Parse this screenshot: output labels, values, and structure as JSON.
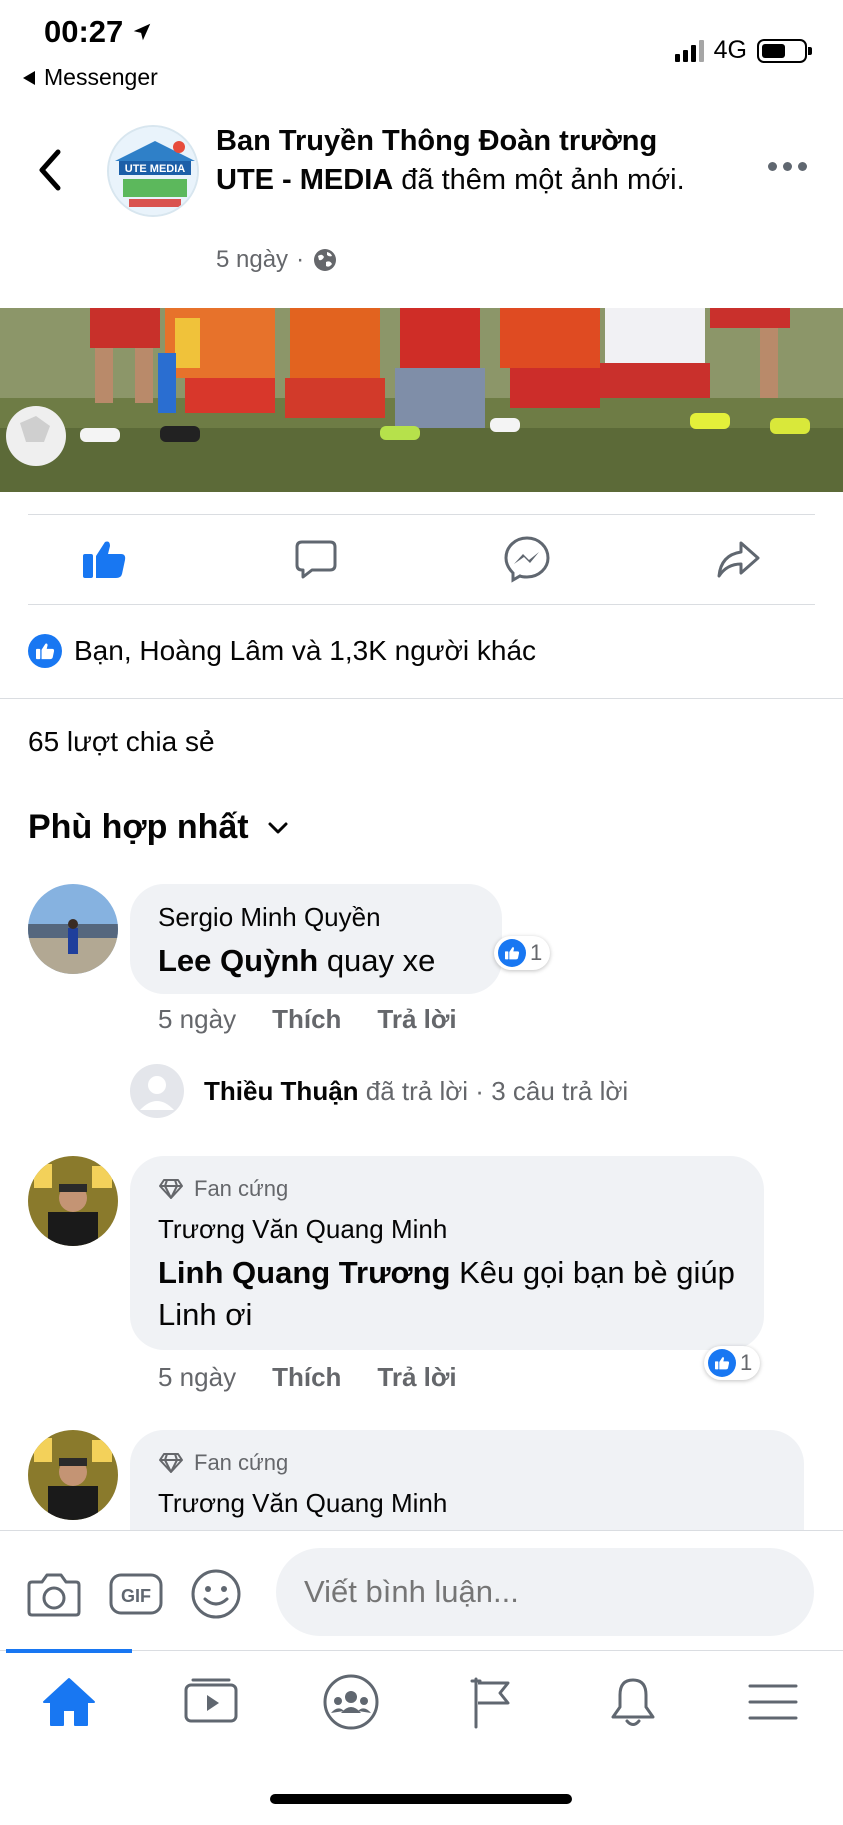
{
  "status_bar": {
    "time": "00:27",
    "back_app": "Messenger",
    "network": "4G"
  },
  "post": {
    "page_name": "Ban Truyền Thông Đoàn trường UTE - MEDIA",
    "action_text": " đã thêm một ảnh mới.",
    "time": "5 ngày",
    "reactions_summary": "Bạn, Hoàng Lâm và 1,3K người khác",
    "shares": "65 lượt chia sẻ"
  },
  "comments_section": {
    "sort_label": "Phù hợp nhất"
  },
  "comments": [
    {
      "author": "Sergio Minh Quyền",
      "tag": "Lee Quỳnh",
      "text": " quay xe",
      "time": "5 ngày",
      "like_label": "Thích",
      "reply_label": "Trả lời",
      "reaction_count": "1"
    },
    {
      "badge": "Fan cứng",
      "author": "Trương Văn Quang Minh",
      "tag": "Linh Quang Trương",
      "text": " Kêu gọi bạn bè giúp Linh ơi",
      "time": "5 ngày",
      "like_label": "Thích",
      "reply_label": "Trả lời",
      "reaction_count": "1"
    },
    {
      "badge": "Fan cứng",
      "author": "Trương Văn Quang Minh"
    }
  ],
  "reply_summary": {
    "author": "Thiều Thuận",
    "text": " đã trả lời · 3 câu trả lời"
  },
  "composer": {
    "placeholder": "Viết bình luận..."
  },
  "icons": {
    "back": "chevron-left-icon",
    "more": "more-icon",
    "like": "like-icon",
    "comment": "comment-icon",
    "messenger": "messenger-icon",
    "share": "share-icon",
    "camera": "camera-icon",
    "gif": "gif-icon",
    "emoji": "emoji-icon",
    "home": "home-icon",
    "watch": "watch-icon",
    "groups": "groups-icon",
    "pages": "flag-icon",
    "notifications": "bell-icon",
    "menu": "menu-icon"
  },
  "colors": {
    "accent": "#1877f2",
    "secondary_text": "#65676b",
    "bubble": "#f0f2f5"
  }
}
